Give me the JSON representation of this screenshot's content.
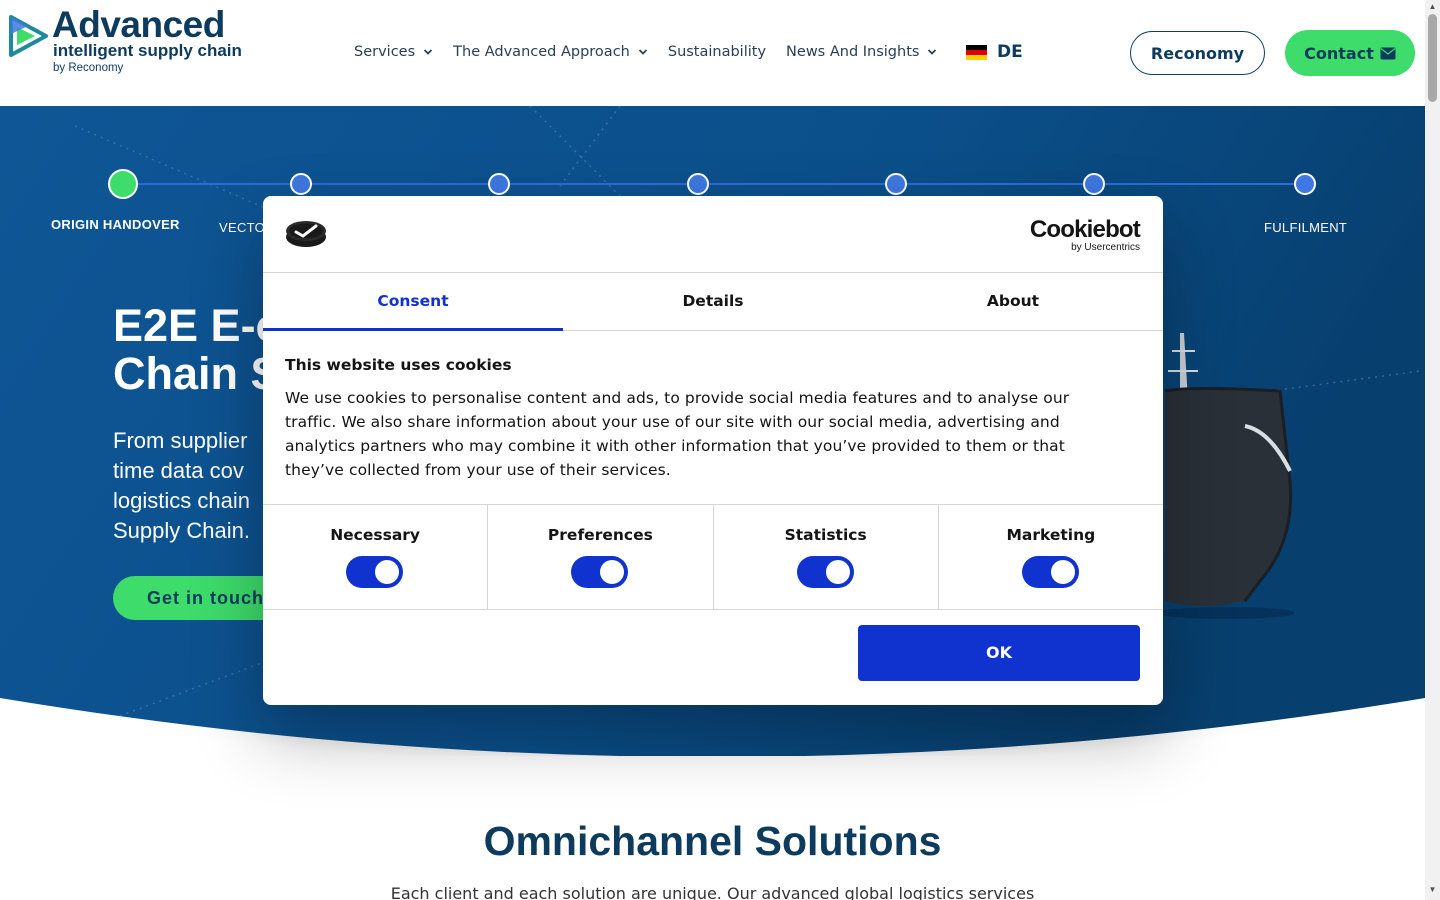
{
  "header": {
    "logo": {
      "title": "Advanced",
      "subtitle": "intelligent supply chain",
      "byline": "by Reconomy"
    },
    "nav": [
      {
        "label": "Services",
        "has_dropdown": true
      },
      {
        "label": "The Advanced Approach",
        "has_dropdown": true
      },
      {
        "label": "Sustainability",
        "has_dropdown": false
      },
      {
        "label": "News And Insights",
        "has_dropdown": true
      }
    ],
    "language": {
      "code": "DE",
      "flag": "germany-flag-icon"
    },
    "reconomy_button": "Reconomy",
    "contact_button": "Contact",
    "contact_icon": "envelope-icon"
  },
  "hero": {
    "steps": [
      {
        "label": "ORIGIN HANDOVER",
        "active": true
      },
      {
        "label": "VECTO",
        "active": false
      },
      {
        "label": "",
        "active": false
      },
      {
        "label": "",
        "active": false
      },
      {
        "label": "",
        "active": false
      },
      {
        "label": "",
        "active": false
      },
      {
        "label": "FULFILMENT",
        "active": false
      }
    ],
    "title_line1": "E2E E-c",
    "title_line2": "Chain S",
    "text_lines": [
      "From supplier",
      "time data cov",
      "logistics chain",
      "Supply Chain."
    ],
    "cta": "Get in touch"
  },
  "section": {
    "title": "Omnichannel Solutions",
    "text": "Each client and each solution are unique. Our advanced global logistics services"
  },
  "cookie_dialog": {
    "brand_name": "Cookiebot",
    "brand_by": "by Usercentrics",
    "tabs": [
      {
        "label": "Consent",
        "active": true
      },
      {
        "label": "Details",
        "active": false
      },
      {
        "label": "About",
        "active": false
      }
    ],
    "heading": "This website uses cookies",
    "body": "We use cookies to personalise content and ads, to provide social media features and to analyse our traffic. We also share information about your use of our site with our social media, advertising and analytics partners who may combine it with other information that you’ve provided to them or that they’ve collected from your use of their services.",
    "toggles": [
      {
        "label": "Necessary",
        "checked": true
      },
      {
        "label": "Preferences",
        "checked": true
      },
      {
        "label": "Statistics",
        "checked": true
      },
      {
        "label": "Marketing",
        "checked": true
      }
    ],
    "ok_button": "OK"
  },
  "colors": {
    "brand_navy": "#0d3b5e",
    "accent_green": "#3ddc6b",
    "hero_blue": "#0f5391",
    "cookiebot_blue": "#1032cf"
  }
}
